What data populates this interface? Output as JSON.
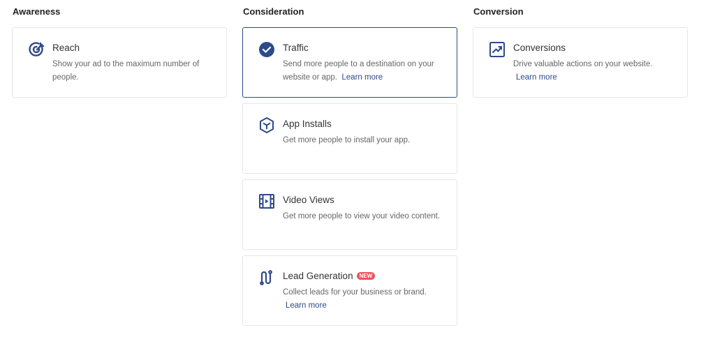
{
  "columns": [
    {
      "heading": "Awareness",
      "cards": [
        {
          "title": "Reach",
          "description": "Show your ad to the maximum number of people.",
          "icon": "target-icon"
        }
      ]
    },
    {
      "heading": "Consideration",
      "cards": [
        {
          "title": "Traffic",
          "description": "Send more people to a destination on your website or app.",
          "learn_more": "Learn more",
          "icon": "check-circle-icon",
          "selected": true
        },
        {
          "title": "App Installs",
          "description": "Get more people to install your app.",
          "icon": "cube-icon"
        },
        {
          "title": "Video Views",
          "description": "Get more people to view your video content.",
          "icon": "film-icon"
        },
        {
          "title": "Lead Generation",
          "badge": "NEW",
          "description": "Collect leads for your business or brand.",
          "learn_more": "Learn more",
          "icon": "funnel-path-icon"
        }
      ]
    },
    {
      "heading": "Conversion",
      "cards": [
        {
          "title": "Conversions",
          "description": "Drive valuable actions on your website.",
          "learn_more": "Learn more",
          "icon": "trend-chart-icon"
        }
      ]
    }
  ],
  "colors": {
    "accent": "#2d4a8a",
    "badge": "#f0505a"
  }
}
